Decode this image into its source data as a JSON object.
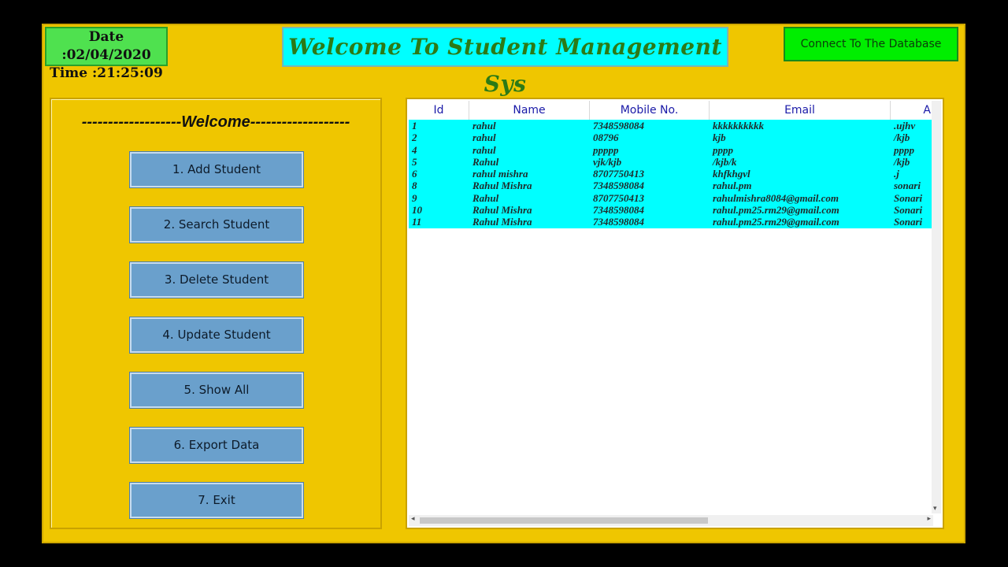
{
  "clock": {
    "date": "Date :02/04/2020",
    "time": "Time :21:25:09"
  },
  "title": "Welcome To Student Management Sys",
  "connect_label": "Connect To The Database",
  "welcome_text": "-------------------Welcome-------------------",
  "buttons": [
    {
      "label": "1.  Add Student"
    },
    {
      "label": "2.  Search Student"
    },
    {
      "label": "3.  Delete Student"
    },
    {
      "label": "4.  Update Student"
    },
    {
      "label": "5.  Show All"
    },
    {
      "label": "6.  Export Data"
    },
    {
      "label": "7.  Exit"
    }
  ],
  "table": {
    "columns": [
      "Id",
      "Name",
      "Mobile No.",
      "Email",
      "A"
    ],
    "rows": [
      [
        "1",
        "rahul",
        "7348598084",
        "kkkkkkkkkk",
        ".ujhv"
      ],
      [
        "2",
        "rahul",
        "08796",
        "kjb",
        "/kjb"
      ],
      [
        "4",
        "rahul",
        "ppppp",
        "pppp",
        "pppp"
      ],
      [
        "5",
        "Rahul",
        "vjk/kjb",
        "/kjb/k",
        "/kjb"
      ],
      [
        "6",
        "rahul mishra",
        "8707750413",
        "khfkhgvl",
        ".j"
      ],
      [
        "8",
        "Rahul Mishra",
        "7348598084",
        "rahul.pm",
        "sonari"
      ],
      [
        "9",
        "Rahul",
        "8707750413",
        "rahulmishra8084@gmail.com",
        "Sonari"
      ],
      [
        "10",
        "Rahul Mishra",
        "7348598084",
        "rahul.pm25.rm29@gmail.com",
        "Sonari"
      ],
      [
        "11",
        "Rahul Mishra",
        "7348598084",
        "rahul.pm25.rm29@gmail.com",
        "Sonari"
      ]
    ]
  },
  "icons": {
    "scroll_left": "◂",
    "scroll_right": "▸",
    "scroll_down": "▾"
  }
}
